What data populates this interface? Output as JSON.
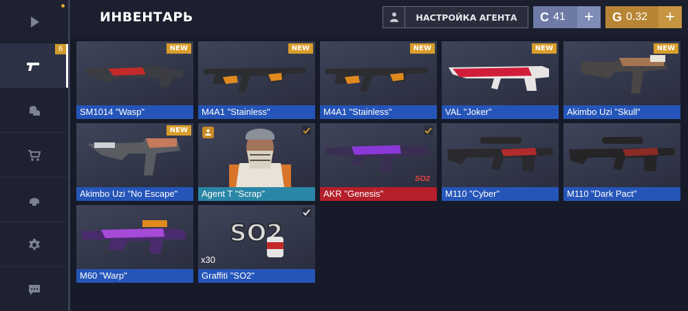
{
  "sidebar": {
    "items": [
      {
        "name": "play",
        "icon": "play-icon"
      },
      {
        "name": "inventory",
        "icon": "pistol-icon",
        "badge": "6"
      },
      {
        "name": "cases",
        "icon": "coins-icon"
      },
      {
        "name": "shop",
        "icon": "cart-icon"
      },
      {
        "name": "clan",
        "icon": "helmet-icon"
      },
      {
        "name": "settings",
        "icon": "gear-icon"
      },
      {
        "name": "chat",
        "icon": "chat-icon"
      }
    ]
  },
  "header": {
    "title": "ИНВЕНТАРЬ",
    "agent_settings_label": "НАСТРОЙКА АГЕНТА",
    "silver_amount": "41",
    "gold_amount": "0.32",
    "plus": "+"
  },
  "items": [
    {
      "name": "SM1014 \"Wasp\"",
      "new": "NEW",
      "color": "#c42a2a"
    },
    {
      "name": "M4A1 \"Stainless\"",
      "new": "NEW",
      "color": "#e08a1e"
    },
    {
      "name": "M4A1 \"Stainless\"",
      "new": "NEW",
      "color": "#e08a1e"
    },
    {
      "name": "VAL \"Joker\"",
      "new": "NEW",
      "color": "#d01e3a"
    },
    {
      "name": "Akimbo Uzi \"Skull\"",
      "new": "NEW",
      "color": "#a47453"
    },
    {
      "name": "Akimbo Uzi \"No Escape\"",
      "new": "NEW",
      "color": "#c47a5c"
    },
    {
      "name": "Agent T \"Scrap\"",
      "equipped": true
    },
    {
      "name": "AKR \"Genesis\"",
      "equipped": true,
      "color": "#8a38d8"
    },
    {
      "name": "M110 \"Cyber\"",
      "color": "#b02c2c"
    },
    {
      "name": "M110 \"Dark Pact\"",
      "color": "#8c2a26"
    },
    {
      "name": "M60 \"Warp\"",
      "color": "#a64ad8"
    },
    {
      "name": "Graffiti \"SO2\"",
      "equipped": true,
      "quantity": "x30"
    }
  ]
}
